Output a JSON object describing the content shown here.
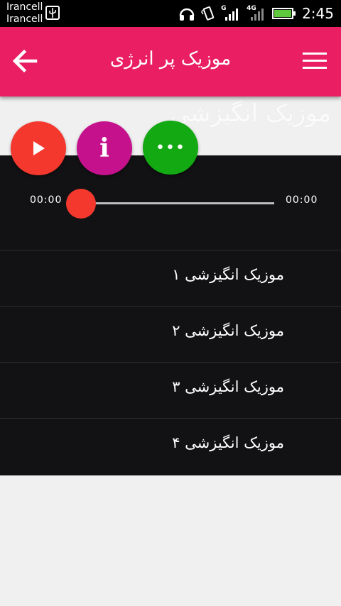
{
  "status_bar": {
    "carrier_1": "Irancell",
    "carrier_2": "Irancell",
    "network_1": "G",
    "network_2": "4G",
    "time": "2:45"
  },
  "app_bar": {
    "title": "موزیک پر انرژی",
    "back_icon": "arrow-left-icon",
    "menu_icon": "hamburger-menu-icon"
  },
  "header": {
    "watermark": "موزیک انگیزشی"
  },
  "player": {
    "play_icon": "play-icon",
    "info_label": "i",
    "more_label": "•••",
    "elapsed": "00:00",
    "duration": "00:00",
    "progress": 0
  },
  "tracks": [
    {
      "label": "موزیک انگیزشی ۱"
    },
    {
      "label": "موزیک انگیزشی ۲"
    },
    {
      "label": "موزیک انگیزشی ۳"
    },
    {
      "label": "موزیک انگیزشی ۴"
    }
  ],
  "colors": {
    "app_bar": "#e91e63",
    "play": "#f4382e",
    "info": "#c5118c",
    "more": "#13a913",
    "panel": "#121214"
  }
}
